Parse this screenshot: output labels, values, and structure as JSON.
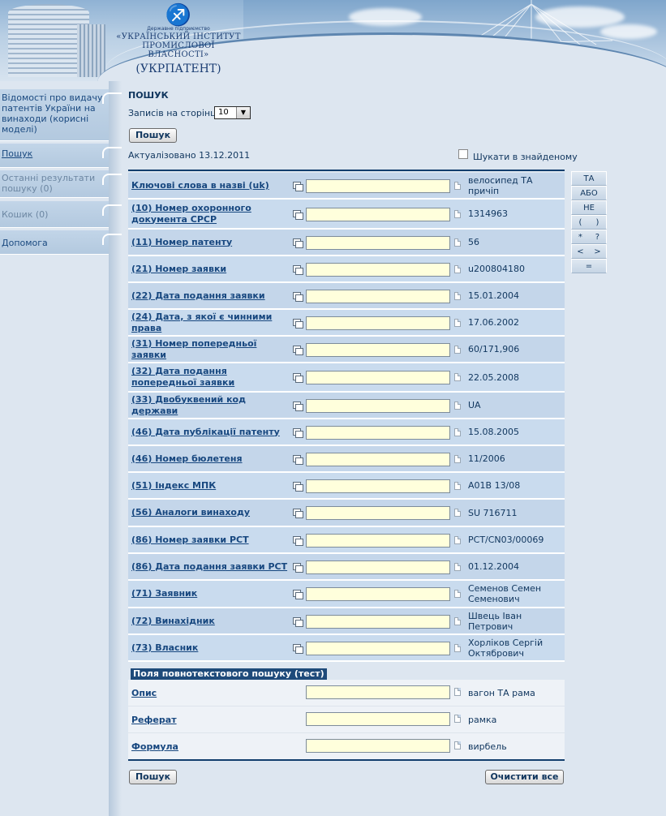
{
  "header": {
    "org_small": "Державне підприємство",
    "org_line1": "«УКРАЇНСЬКИЙ ІНСТИТУТ",
    "org_line2": "ПРОМИСЛОВОЇ ВЛАСНОСТІ»",
    "org_abbr": "(УКРПАТЕНТ)"
  },
  "sidebar": {
    "items": [
      {
        "label": "Відомості про видачу патентів України на винаходи (корисні моделі)"
      },
      {
        "label": "Пошук"
      },
      {
        "label": "Останні результати пошуку (0)"
      },
      {
        "label": "Кошик (0)"
      },
      {
        "label": "Допомога"
      }
    ]
  },
  "search": {
    "title": "ПОШУК",
    "per_page_label": "Записів на сторінці",
    "per_page_value": "10",
    "search_button": "Пошук",
    "updated": "Актуалізовано 13.12.2011",
    "search_in_found": "Шукати в знайденому",
    "clear_button": "Очистити все"
  },
  "operators": {
    "and": "ТА",
    "or": "АБО",
    "not": "НЕ",
    "paren_open": "(",
    "paren_close": ")",
    "star": "*",
    "question": "?",
    "lt": "<",
    "gt": ">",
    "eq": "="
  },
  "fields": [
    {
      "label": "Ключові слова в назві (uk)",
      "example": "велосипед ТА причіп"
    },
    {
      "label": "(10) Номер охоронного документа СРСР",
      "example": "1314963"
    },
    {
      "label": "(11) Номер патенту",
      "example": "56"
    },
    {
      "label": "(21) Номер заявки",
      "example": "u200804180"
    },
    {
      "label": "(22) Дата подання заявки",
      "example": "15.01.2004"
    },
    {
      "label": "(24) Дата, з якої є чинними права",
      "example": "17.06.2002"
    },
    {
      "label": "(31) Номер попередньої заявки",
      "example": "60/171,906"
    },
    {
      "label": "(32) Дата подання попередньої заявки",
      "example": "22.05.2008"
    },
    {
      "label": "(33) Двобуквений код держави",
      "example": "UA"
    },
    {
      "label": "(46) Дата публікації патенту",
      "example": "15.08.2005"
    },
    {
      "label": "(46) Номер бюлетеня",
      "example": "11/2006"
    },
    {
      "label": "(51) Індекс МПК",
      "example": "A01B 13/08"
    },
    {
      "label": "(56) Аналоги винаходу",
      "example": "SU 716711"
    },
    {
      "label": "(86) Номер заявки РСТ",
      "example": "PCT/CN03/00069"
    },
    {
      "label": "(86) Дата подання заявки РСТ",
      "example": "01.12.2004"
    },
    {
      "label": "(71) Заявник",
      "example": "Семенов Семен Семенович"
    },
    {
      "label": "(72) Винахідник",
      "example": "Швець Іван Петрович"
    },
    {
      "label": "(73) Власник",
      "example": "Хорліков Сергій Октябрович"
    }
  ],
  "fulltext": {
    "header": "Поля повнотекстового пошуку (тест)",
    "fields": [
      {
        "label": "Опис",
        "example": "вагон ТА рама"
      },
      {
        "label": "Реферат",
        "example": "рамка"
      },
      {
        "label": "Формула",
        "example": "вирбель"
      }
    ]
  }
}
